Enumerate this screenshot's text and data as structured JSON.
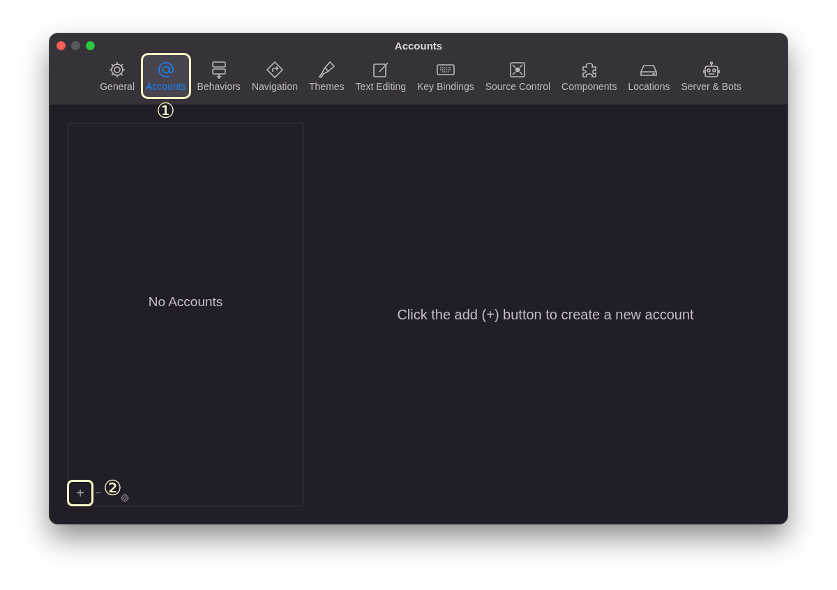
{
  "window": {
    "title": "Accounts"
  },
  "tabs": [
    {
      "label": "General",
      "selected": false,
      "highlighted": false
    },
    {
      "label": "Accounts",
      "selected": true,
      "highlighted": true
    },
    {
      "label": "Behaviors",
      "selected": false,
      "highlighted": false
    },
    {
      "label": "Navigation",
      "selected": false,
      "highlighted": false
    },
    {
      "label": "Themes",
      "selected": false,
      "highlighted": false
    },
    {
      "label": "Text Editing",
      "selected": false,
      "highlighted": false
    },
    {
      "label": "Key Bindings",
      "selected": false,
      "highlighted": false
    },
    {
      "label": "Source Control",
      "selected": false,
      "highlighted": false
    },
    {
      "label": "Components",
      "selected": false,
      "highlighted": false
    },
    {
      "label": "Locations",
      "selected": false,
      "highlighted": false
    },
    {
      "label": "Server & Bots",
      "selected": false,
      "highlighted": false
    }
  ],
  "callouts": [
    "①",
    "②"
  ],
  "accounts_list": {
    "empty_text": "No Accounts",
    "add_button": {
      "label": "+",
      "highlighted": true
    },
    "remove_button": {
      "label": "−"
    }
  },
  "detail": {
    "message": "Click the add (+) button to create a new account"
  }
}
